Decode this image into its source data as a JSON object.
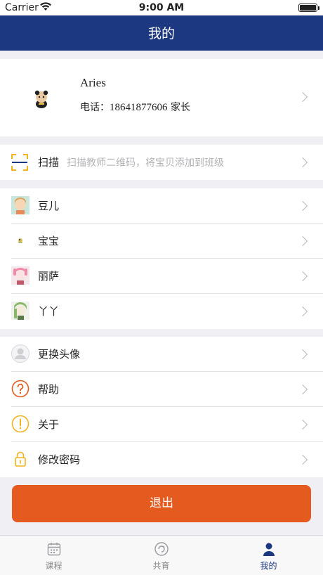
{
  "status_bar": {
    "carrier": "Carrier",
    "time": "9:00 AM"
  },
  "nav": {
    "title": "我的"
  },
  "profile": {
    "name": "Aries",
    "phone_label": "电话：",
    "phone": "18641877606",
    "role": " 家长"
  },
  "scan": {
    "label": "扫描",
    "hint": "扫描教师二维码，将宝贝添加到班级"
  },
  "children": [
    {
      "name": "豆儿"
    },
    {
      "name": "宝宝"
    },
    {
      "name": "丽萨"
    },
    {
      "name": "丫丫"
    }
  ],
  "settings": [
    {
      "label": "更换头像",
      "icon": "user-avatar-icon"
    },
    {
      "label": "帮助",
      "icon": "question-icon"
    },
    {
      "label": "关于",
      "icon": "exclamation-icon"
    },
    {
      "label": "修改密码",
      "icon": "lock-icon"
    }
  ],
  "logout": {
    "label": "退出"
  },
  "tabs": [
    {
      "label": "课程",
      "icon": "calendar-icon"
    },
    {
      "label": "共育",
      "icon": "refresh-circle-icon"
    },
    {
      "label": "我的",
      "icon": "person-icon"
    }
  ],
  "colors": {
    "nav": "#1c3880",
    "logout": "#e55a1e",
    "scan_icon": "#f2b31b",
    "help_icon": "#e55a1e",
    "about_icon": "#f2b31b",
    "lock_icon": "#f2b31b"
  }
}
